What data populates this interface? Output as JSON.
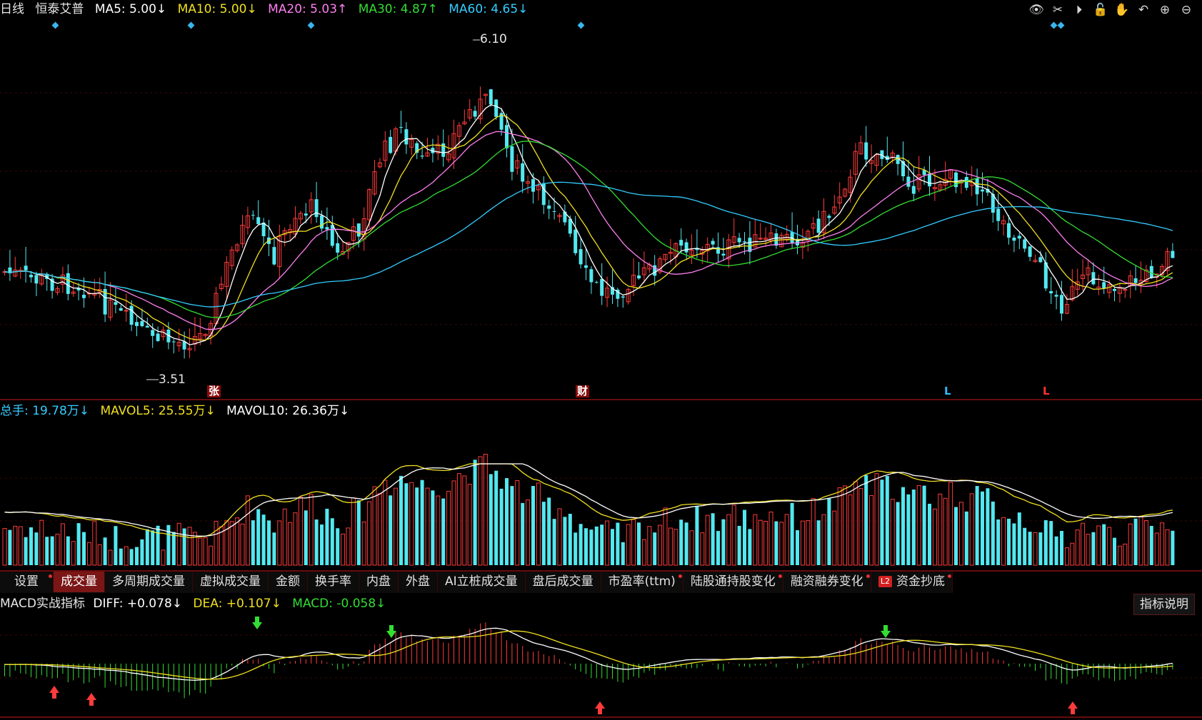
{
  "header": {
    "period": "日线",
    "stock_name": "恒泰艾普",
    "ma": [
      {
        "label": "MA5: 5.00↓",
        "color": "#ffffff"
      },
      {
        "label": "MA10: 5.00↓",
        "color": "#f0e020"
      },
      {
        "label": "MA20: 5.03↑",
        "color": "#ff7ff0"
      },
      {
        "label": "MA30: 4.87↑",
        "color": "#33dd33"
      },
      {
        "label": "MA60: 4.65↓",
        "color": "#33ccff"
      }
    ]
  },
  "toolbar": {
    "icons": [
      "eye-icon",
      "scissors-icon",
      "play-icon",
      "lock-icon",
      "hand-icon",
      "undo-icon",
      "zoom-in-icon",
      "zoom-out-icon"
    ],
    "glyphs": [
      "👁",
      "✂",
      "⏵",
      "🔓",
      "✋",
      "↶",
      "⊕",
      "⊖"
    ]
  },
  "price_chart": {
    "high_label": "6.10",
    "low_label": "3.51",
    "markers": [
      {
        "text": "张",
        "bg": "#8a0b0b",
        "color": "#ffffff"
      },
      {
        "text": "财",
        "bg": "#8a0b0b",
        "color": "#ffffff"
      },
      {
        "text": "L",
        "bg": "transparent",
        "color": "#33bbff"
      },
      {
        "text": "L",
        "bg": "transparent",
        "color": "#ff3333"
      }
    ]
  },
  "volume_header": [
    {
      "label": "总手: 19.78万↓",
      "color": "#33ccff"
    },
    {
      "label": "MAVOL5: 25.55万↓",
      "color": "#f0e020"
    },
    {
      "label": "MAVOL10: 26.36万↓",
      "color": "#ffffff"
    }
  ],
  "tabs": [
    {
      "label": "设置",
      "dot": true,
      "active": false,
      "l2": false
    },
    {
      "label": "成交量",
      "dot": false,
      "active": true,
      "l2": false
    },
    {
      "label": "多周期成交量",
      "dot": false,
      "active": false,
      "l2": false
    },
    {
      "label": "虚拟成交量",
      "dot": false,
      "active": false,
      "l2": false
    },
    {
      "label": "金额",
      "dot": false,
      "active": false,
      "l2": false
    },
    {
      "label": "换手率",
      "dot": false,
      "active": false,
      "l2": false
    },
    {
      "label": "内盘",
      "dot": false,
      "active": false,
      "l2": false
    },
    {
      "label": "外盘",
      "dot": false,
      "active": false,
      "l2": false
    },
    {
      "label": "AI立桩成交量",
      "dot": false,
      "active": false,
      "l2": false
    },
    {
      "label": "盘后成交量",
      "dot": false,
      "active": false,
      "l2": false
    },
    {
      "label": "市盈率(ttm)",
      "dot": true,
      "active": false,
      "l2": false
    },
    {
      "label": "陆股通持股变化",
      "dot": true,
      "active": false,
      "l2": false
    },
    {
      "label": "融资融券变化",
      "dot": true,
      "active": false,
      "l2": false
    },
    {
      "label": "资金抄底",
      "dot": true,
      "active": false,
      "l2": true,
      "l2_text": "L2"
    }
  ],
  "macd_header": {
    "title": "MACD实战指标",
    "items": [
      {
        "label": "DIFF: +0.078↓",
        "color": "#ffffff"
      },
      {
        "label": "DEA: +0.107↓",
        "color": "#f0e020"
      },
      {
        "label": "MACD: -0.058↓",
        "color": "#33dd33"
      }
    ]
  },
  "explain_button": "指标说明",
  "chart_data": {
    "type": "candlestick",
    "high": 6.1,
    "low": 3.51,
    "ma_lines": [
      "MA5",
      "MA10",
      "MA20",
      "MA30",
      "MA60"
    ],
    "volume_lines": [
      "MAVOL5",
      "MAVOL10"
    ],
    "macd_lines": [
      "DIFF",
      "DEA",
      "MACD"
    ]
  }
}
